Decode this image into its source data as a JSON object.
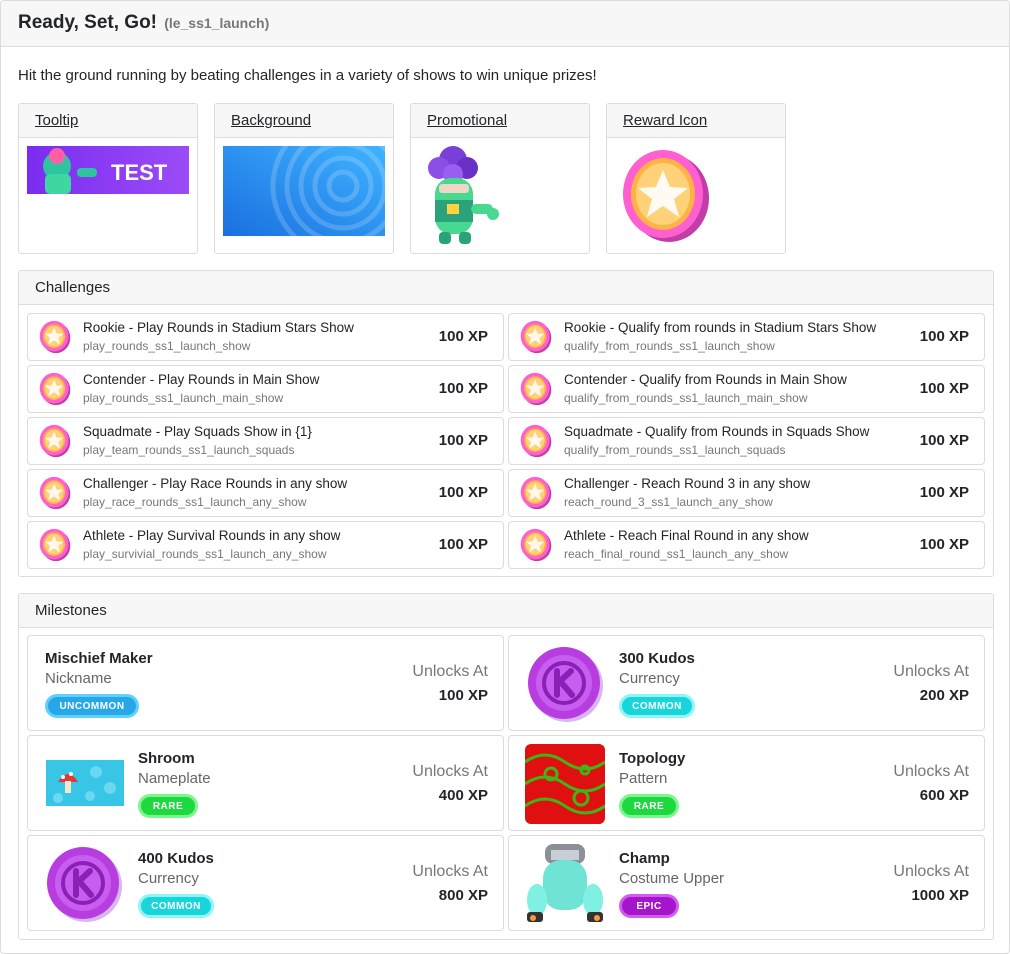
{
  "header": {
    "title": "Ready, Set, Go!",
    "id": "(le_ss1_launch)"
  },
  "intro": "Hit the ground running by beating challenges in a variety of shows to win unique prizes!",
  "assets": [
    {
      "label": "Tooltip",
      "image_text": "TEST"
    },
    {
      "label": "Background"
    },
    {
      "label": "Promotional"
    },
    {
      "label": "Reward Icon"
    }
  ],
  "challenges": {
    "title": "Challenges",
    "items": [
      {
        "name": "Rookie - Play Rounds in Stadium Stars Show",
        "id": "play_rounds_ss1_launch_show",
        "xp": "100 XP"
      },
      {
        "name": "Rookie - Qualify from rounds in Stadium Stars Show",
        "id": "qualify_from_rounds_ss1_launch_show",
        "xp": "100 XP"
      },
      {
        "name": "Contender - Play Rounds in Main Show",
        "id": "play_rounds_ss1_launch_main_show",
        "xp": "100 XP"
      },
      {
        "name": "Contender - Qualify from Rounds in Main Show",
        "id": "qualify_from_rounds_ss1_launch_main_show",
        "xp": "100 XP"
      },
      {
        "name": "Squadmate - Play Squads Show in {1}",
        "id": "play_team_rounds_ss1_launch_squads",
        "xp": "100 XP"
      },
      {
        "name": "Squadmate - Qualify from Rounds in Squads Show",
        "id": "qualify_from_rounds_ss1_launch_squads",
        "xp": "100 XP"
      },
      {
        "name": "Challenger - Play Race Rounds in any show",
        "id": "play_race_rounds_ss1_launch_any_show",
        "xp": "100 XP"
      },
      {
        "name": "Challenger - Reach Round 3 in any show",
        "id": "reach_round_3_ss1_launch_any_show",
        "xp": "100 XP"
      },
      {
        "name": "Athlete - Play Survival Rounds in any show",
        "id": "play_survivial_rounds_ss1_launch_any_show",
        "xp": "100 XP"
      },
      {
        "name": "Athlete - Reach Final Round in any show",
        "id": "reach_final_round_ss1_launch_any_show",
        "xp": "100 XP"
      }
    ]
  },
  "milestones": {
    "title": "Milestones",
    "unlocks_label": "Unlocks At",
    "items": [
      {
        "name": "Mischief Maker",
        "type": "Nickname",
        "rarity": "UNCOMMON",
        "xp": "100 XP",
        "image": "none"
      },
      {
        "name": "300 Kudos",
        "type": "Currency",
        "rarity": "COMMON",
        "xp": "200 XP",
        "image": "kudos-coin"
      },
      {
        "name": "Shroom",
        "type": "Nameplate",
        "rarity": "RARE",
        "xp": "400 XP",
        "image": "mushroom-nameplate"
      },
      {
        "name": "Topology",
        "type": "Pattern",
        "rarity": "RARE",
        "xp": "600 XP",
        "image": "topology-pattern"
      },
      {
        "name": "400 Kudos",
        "type": "Currency",
        "rarity": "COMMON",
        "xp": "800 XP",
        "image": "kudos-coin"
      },
      {
        "name": "Champ",
        "type": "Costume Upper",
        "rarity": "EPIC",
        "xp": "1000 XP",
        "image": "costume-upper"
      }
    ]
  },
  "rarity_colors": {
    "UNCOMMON": {
      "fill": "#27a6e8",
      "border": "#5ed1ff"
    },
    "COMMON": {
      "fill": "#18d5dc",
      "border": "#8ff6f4"
    },
    "RARE": {
      "fill": "#1ed83f",
      "border": "#7cf58c"
    },
    "EPIC": {
      "fill": "#a515c9",
      "border": "#d25cf0"
    }
  },
  "accent_colors": {
    "reward_coin": "#ff8fd4",
    "kudos": "#b83de0"
  }
}
